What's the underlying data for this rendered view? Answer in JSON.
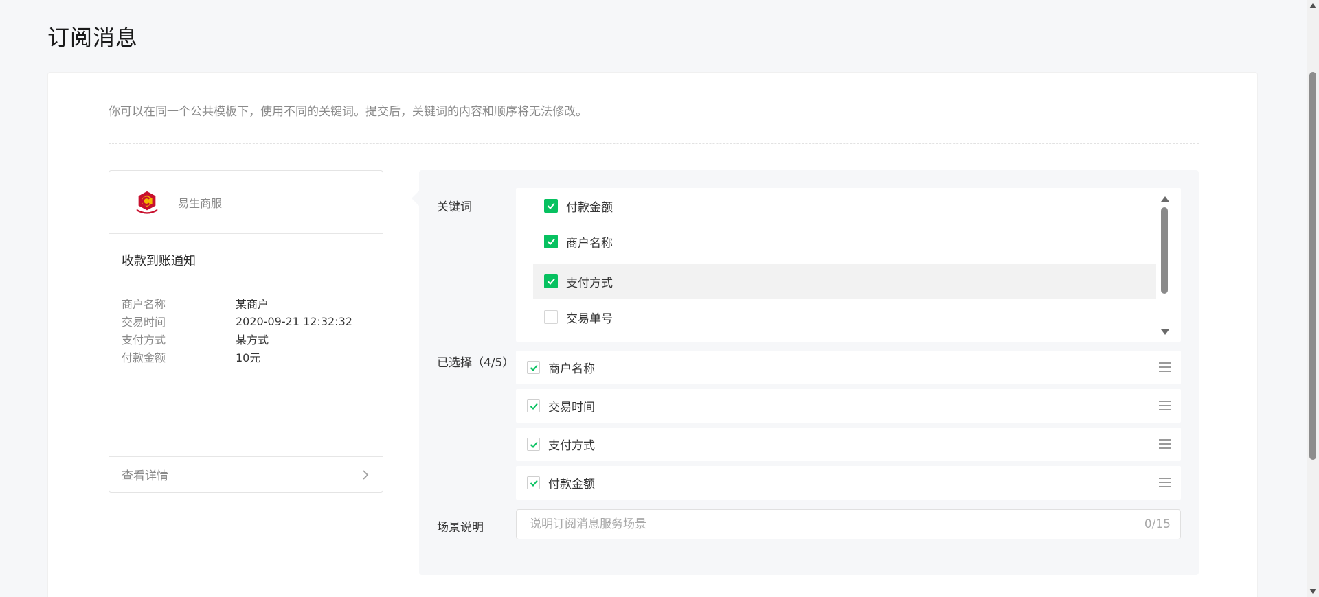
{
  "page": {
    "title": "订阅消息"
  },
  "hint": "你可以在同一个公共模板下，使用不同的关键词。提交后，关键词的内容和顺序将无法修改。",
  "preview": {
    "brand_name": "易生商服",
    "message_title": "收款到账通知",
    "fields": [
      {
        "label": "商户名称",
        "value": "某商户"
      },
      {
        "label": "交易时间",
        "value": "2020-09-21 12:32:32"
      },
      {
        "label": "支付方式",
        "value": "某方式"
      },
      {
        "label": "付款金额",
        "value": "10元"
      }
    ],
    "detail_link": "查看详情"
  },
  "config": {
    "keywords_label": "关键词",
    "keywords": [
      {
        "label": "付款金额",
        "checked": true
      },
      {
        "label": "商户名称",
        "checked": true
      },
      {
        "label": "支付方式",
        "checked": true
      },
      {
        "label": "交易单号",
        "checked": false
      }
    ],
    "selected_label": "已选择（4/5）",
    "selected": [
      {
        "label": "商户名称"
      },
      {
        "label": "交易时间"
      },
      {
        "label": "支付方式"
      },
      {
        "label": "付款金额"
      }
    ],
    "scene_label": "场景说明",
    "scene_placeholder": "说明订阅消息服务场景",
    "scene_value": "",
    "scene_counter": "0/15"
  },
  "colors": {
    "accent": "#07c160",
    "logo_red": "#c8102e",
    "logo_gold": "#f5b800"
  },
  "icons": [
    "brand-logo",
    "checkbox-checked-icon",
    "checkbox-empty-icon",
    "checkmark-icon",
    "drag-handle-icon",
    "chevron-right-icon"
  ]
}
